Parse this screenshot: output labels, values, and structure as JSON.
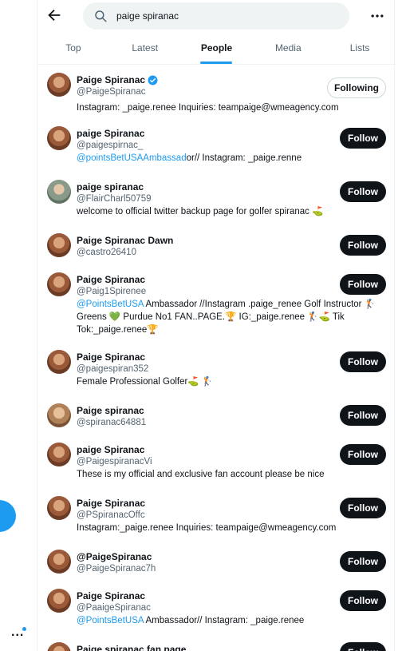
{
  "search": {
    "query": "paige spiranac"
  },
  "tabs": [
    {
      "label": "Top",
      "active": false
    },
    {
      "label": "Latest",
      "active": false
    },
    {
      "label": "People",
      "active": true
    },
    {
      "label": "Media",
      "active": false
    },
    {
      "label": "Lists",
      "active": false
    }
  ],
  "colors": {
    "accent": "#1d9bf0",
    "text": "#0f1419",
    "muted": "#536471",
    "follow_bg": "#0f1419"
  },
  "icons": {
    "back": "arrow-left-icon",
    "search": "search-icon",
    "more": "more-horizontal-icon",
    "verified": "verified-badge-icon",
    "rail_more": "more-dots-icon"
  },
  "rail": {
    "more_label": "..."
  },
  "people": [
    {
      "name": "Paige Spiranac",
      "verified": true,
      "handle": "@PaigeSpiranac",
      "bio_link": "",
      "bio": "Instagram: _paige.renee Inquiries: teampaige@wmeagency.com",
      "button": "Following"
    },
    {
      "name": "paige Spiranac",
      "handle": "@paigespirnac_",
      "bio_link": "@pointsBetUSAAmbassad",
      "bio": "or// Instagram: _paige.renne",
      "button": "Follow"
    },
    {
      "name": "paige spiranac",
      "handle": "@FlairCharl50759",
      "bio_link": "",
      "bio": "welcome to official twitter backup page for golfer spiranac ⛳",
      "button": "Follow"
    },
    {
      "name": "Paige Spiranac Dawn",
      "handle": "@castro26410",
      "bio_link": "",
      "bio": "",
      "button": "Follow"
    },
    {
      "name": "Paige Spiranac",
      "handle": "@Paig1Spirenee",
      "bio_link": "@PointsBetUSA",
      "bio": " Ambassador //Instagram .paige_renee Golf Instructor 🏌 Greens 💚 Purdue No1 FAN..PAGE.🏆 IG:_paige.renee 🏌⛳ Tik Tok:_paige.renee🏆",
      "button": "Follow"
    },
    {
      "name": "Paige Spiranac",
      "handle": "@paigespiran352",
      "bio_link": "",
      "bio": "Female Professional Golfer⛳ 🏌",
      "button": "Follow"
    },
    {
      "name": "Paige spiranac",
      "handle": "@spiranac64881",
      "bio_link": "",
      "bio": "",
      "button": "Follow"
    },
    {
      "name": "paige Spiranac",
      "handle": "@PaigespiranacVi",
      "bio_link": "",
      "bio": "These is my official and exclusive fan account please be nice",
      "button": "Follow"
    },
    {
      "name": "Paige Spiranac",
      "handle": "@PSpiranacOffc",
      "bio_link": "",
      "bio": "Instagram:_paige.renee Inquiries: teampaige@wmeagency.com",
      "button": "Follow"
    },
    {
      "name": "@PaigeSpiranac",
      "handle": "@PaigeSpiranac7h",
      "bio_link": "",
      "bio": "",
      "button": "Follow"
    },
    {
      "name": "Paige Spiranac",
      "handle": "@PaaigeSpiranac",
      "bio_link": "@PointsBetUSA",
      "bio": " Ambassador// Instagram: _paige.renee",
      "button": "Follow"
    },
    {
      "name": "Paige spiranac fan page",
      "handle": "",
      "bio_link": "",
      "bio": "",
      "button": "Follow"
    }
  ]
}
